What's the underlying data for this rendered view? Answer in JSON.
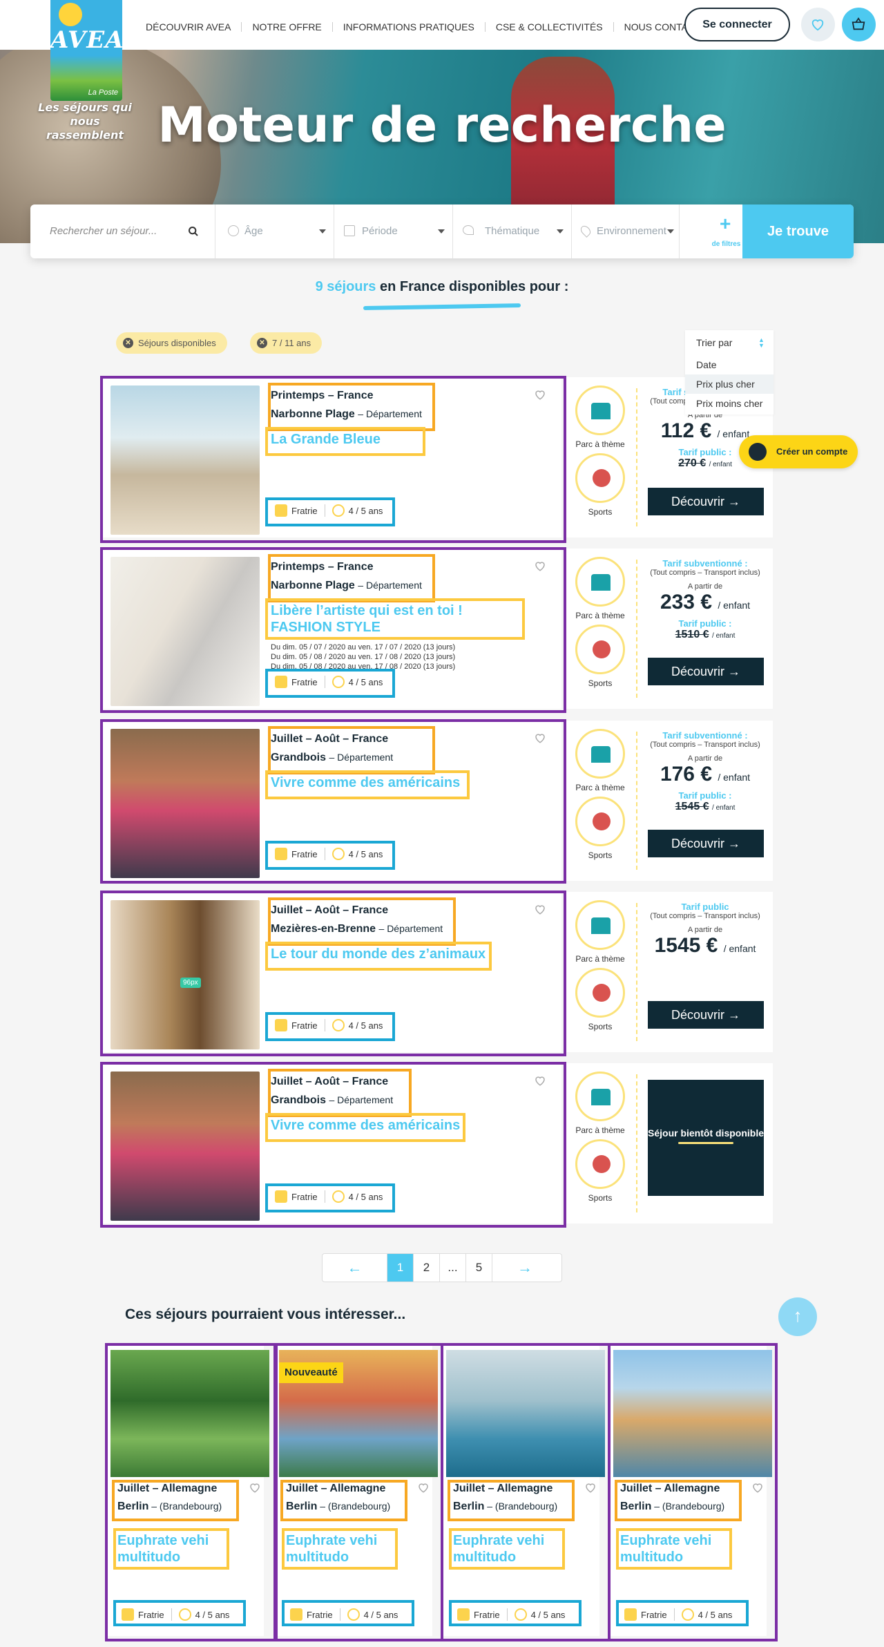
{
  "nav": {
    "items": [
      "Découvrir AVEA",
      "Notre offre",
      "Informations pratiques",
      "CSE & collectivités",
      "Nous contacter"
    ],
    "login": "Se connecter"
  },
  "logo": {
    "brand": "AVEA",
    "sub": "La Poste",
    "tagline": "Les séjours qui nous rassemblent"
  },
  "hero": {
    "title": "Moteur de recherche"
  },
  "search": {
    "placeholder": "Rechercher un séjour...",
    "age": "Âge",
    "period": "Période",
    "theme": "Thématique",
    "env": "Environnement",
    "filters": "de filtres",
    "submit": "Je trouve"
  },
  "results": {
    "count": "9 séjours",
    "rest": "en France disponibles pour :"
  },
  "chips": [
    "Séjours disponibles",
    "7 / 11 ans"
  ],
  "sort": {
    "label": "Trier par",
    "options": [
      "Date",
      "Prix plus cher",
      "Prix moins cher"
    ]
  },
  "create_account": "Créer un compte",
  "tag_labels": {
    "fratrie": "Fratrie",
    "age": "4 / 5 ans"
  },
  "themes": {
    "park": "Parc à thème",
    "sports": "Sports"
  },
  "discover": "Découvrir →",
  "departement": "Département",
  "cards": [
    {
      "season": "Printemps – France",
      "place": "Narbonne Plage",
      "name": "La Grande Bleue",
      "dates": [],
      "price_label": "Tarif subventionné :",
      "price_note": "(Tout compris – Transport inclus)",
      "from": "A partir de",
      "price": "112 €",
      "unit": "/ enfant",
      "public_label": "Tarif public :",
      "public_price": "270 €",
      "public_unit": "/ enfant"
    },
    {
      "season": "Printemps – France",
      "place": "Narbonne Plage",
      "name": "Libère l’artiste qui est en toi ! FASHION STYLE",
      "dates": [
        "Du dim. 05 / 07 / 2020 au ven. 17 / 07 / 2020 (13 jours)",
        "Du dim. 05 / 08 / 2020 au ven. 17 / 08 / 2020 (13 jours)",
        "Du dim. 05 / 08 / 2020 au ven. 17 / 08 / 2020 (13 jours)"
      ],
      "price_label": "Tarif subventionné :",
      "price_note": "(Tout compris – Transport inclus)",
      "from": "A partir de",
      "price": "233 €",
      "unit": "/ enfant",
      "public_label": "Tarif public :",
      "public_price": "1510 €",
      "public_unit": "/ enfant"
    },
    {
      "season": "Juillet – Août – France",
      "place": "Grandbois",
      "name": "Vivre comme des américains",
      "dates": [],
      "price_label": "Tarif subventionné :",
      "price_note": "(Tout compris – Transport inclus)",
      "from": "A partir de",
      "price": "176 €",
      "unit": "/ enfant",
      "public_label": "Tarif public :",
      "public_price": "1545 €",
      "public_unit": "/ enfant"
    },
    {
      "season": "Juillet – Août – France",
      "place": "Mezières-en-Brenne",
      "name": "Le tour du monde des z’animaux",
      "dates": [],
      "price_label": "Tarif public",
      "price_note": "(Tout compris – Transport inclus)",
      "from": "A partir de",
      "price": "1545 €",
      "unit": "/ enfant",
      "px_label": "96px"
    },
    {
      "season": "Juillet – Août – France",
      "place": "Grandbois",
      "name": "Vivre comme des américains",
      "dates": [],
      "soon": "Séjour bientôt disponible"
    }
  ],
  "pagination": {
    "prev": "←",
    "pages": [
      "1",
      "2",
      "...",
      "5"
    ],
    "next": "→"
  },
  "reco": {
    "title": "Ces séjours pourraient vous intéresser...",
    "badge": "Nouveauté",
    "cards": [
      {
        "season": "Juillet – Allemagne",
        "place": "Berlin",
        "region": "(Brandebourg)",
        "name": "Euphrate vehi multitudo"
      },
      {
        "season": "Juillet – Allemagne",
        "place": "Berlin",
        "region": "(Brandebourg)",
        "name": "Euphrate vehi multitudo"
      },
      {
        "season": "Juillet – Allemagne",
        "place": "Berlin",
        "region": "(Brandebourg)",
        "name": "Euphrate vehi multitudo"
      },
      {
        "season": "Juillet – Allemagne",
        "place": "Berlin",
        "region": "(Brandebourg)",
        "name": "Euphrate vehi multitudo"
      }
    ]
  },
  "colors": {
    "accent": "#4dc9f0",
    "dark": "#0f2a36",
    "chip": "#fbeaa5",
    "yellow": "#fcd516",
    "frame_purple": "#7b2ea5",
    "frame_orange": "#f7a823",
    "frame_yellow": "#fcc93f",
    "frame_blue": "#1aa7d4"
  }
}
